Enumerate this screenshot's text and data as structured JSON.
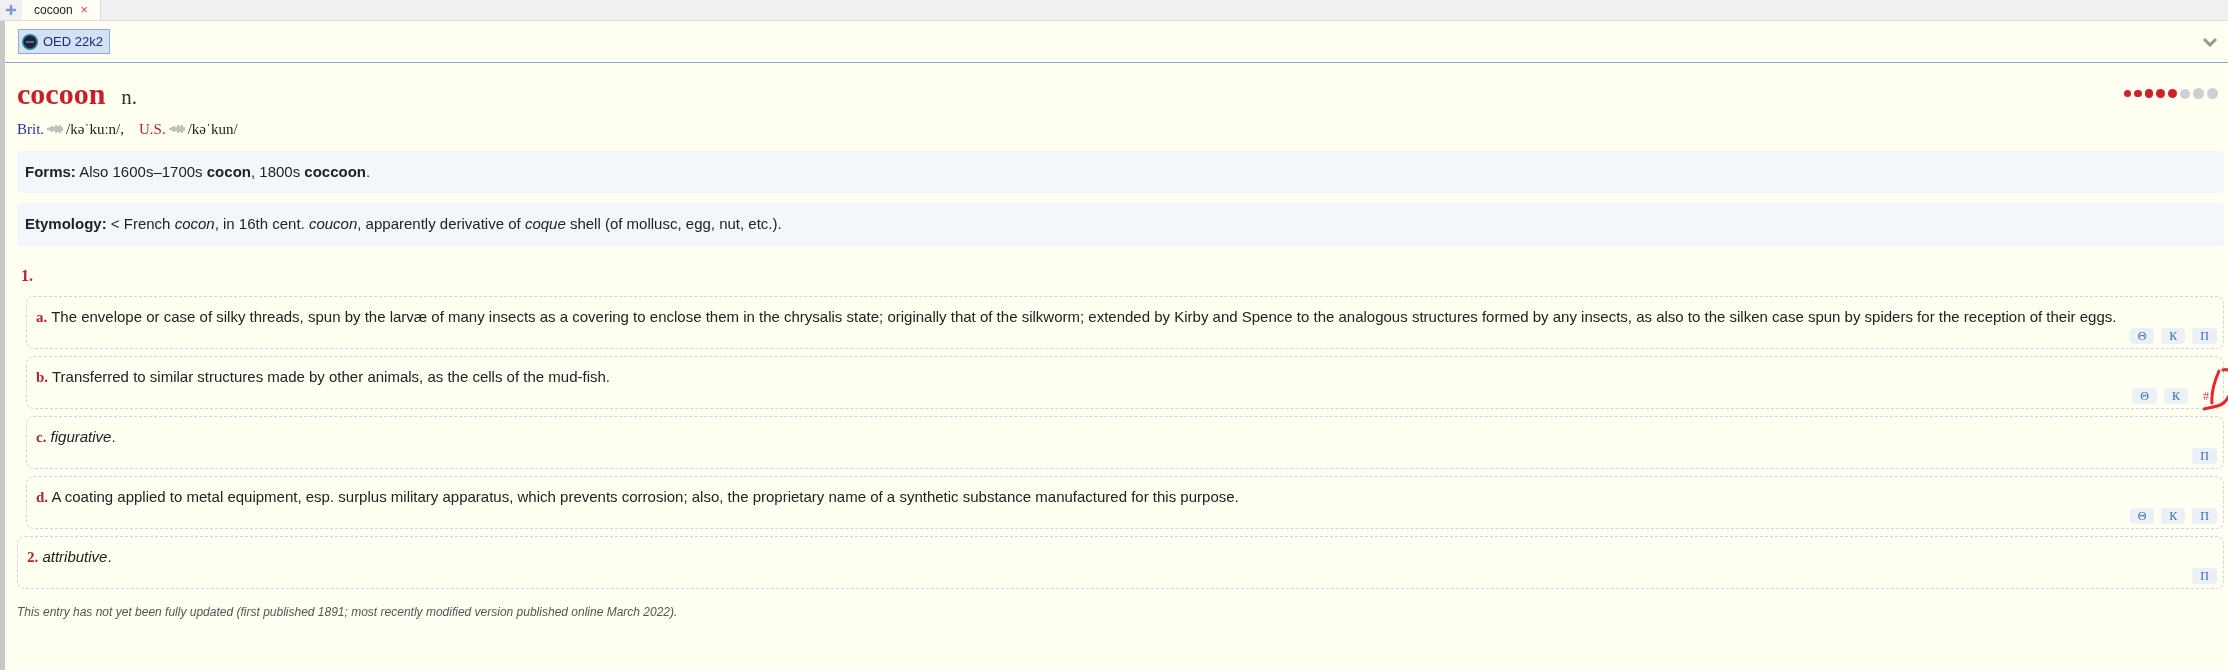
{
  "tabs": [
    {
      "label": "cocoon",
      "selected": true,
      "close": "×"
    }
  ],
  "dictionaries": [
    {
      "label": "OED 22k2",
      "selected": true
    }
  ],
  "entry": {
    "headword": "cocoon",
    "pos": "n.",
    "frequency": {
      "stars": 5
    },
    "pronunciations": [
      {
        "label": "Brit.",
        "ipa": "/kəˈkuːn/,",
        "color": "#2b2f9e"
      },
      {
        "label": "U.S.",
        "ipa": "/kəˈkun/",
        "color": "#b3262b"
      }
    ],
    "forms": {
      "label": "Forms:",
      "text": "Also 1600s–1700s **cocon**, 1800s **coccoon**."
    },
    "etymology": {
      "label": "Etymology:",
      "text": "< French *cocon*, in 16th cent. *coucon*, apparently derivative of *coque* shell (of mollusc, egg, nut, etc.)."
    },
    "senses": [
      {
        "number": "1.",
        "subsenses": [
          {
            "letter": "a.",
            "text": "The envelope or case of silky threads, spun by the larvæ of many insects as a covering to enclose them in the chrysalis state; originally that of the silkworm; extended by Kirby and Spence to the analogous structures formed by any insects, as also to the silken case spun by spiders for the reception of their eggs.",
            "buttons": [
              {
                "label": "Θ",
                "highlighted": false
              },
              {
                "label": "К",
                "highlighted": false
              },
              {
                "label": "П",
                "highlighted": false
              }
            ]
          },
          {
            "letter": "b.",
            "text": "Transferred to similar structures made by other animals, as the cells of the mud-fish.",
            "buttons": [
              {
                "label": "Θ",
                "highlighted": false
              },
              {
                "label": "К",
                "highlighted": false
              },
              {
                "label": "#",
                "highlighted": true
              }
            ]
          },
          {
            "letter": "c.",
            "text": "*figurative*.",
            "buttons": [
              {
                "label": "П",
                "highlighted": false
              }
            ]
          },
          {
            "letter": "d.",
            "text": "A coating applied to metal equipment, esp. surplus military apparatus, which prevents corrosion; also, the proprietary name of a synthetic substance manufactured for this purpose.",
            "buttons": [
              {
                "label": "Θ",
                "highlighted": false
              },
              {
                "label": "К",
                "highlighted": false
              },
              {
                "label": "П",
                "highlighted": false
              }
            ]
          }
        ]
      },
      {
        "number": "2.",
        "text": "*attributive*.",
        "buttons": [
          {
            "label": "П",
            "highlighted": false
          }
        ]
      }
    ],
    "note": "This entry has not yet been fully updated (first published 1891; most recently modified version published online March 2022)."
  }
}
